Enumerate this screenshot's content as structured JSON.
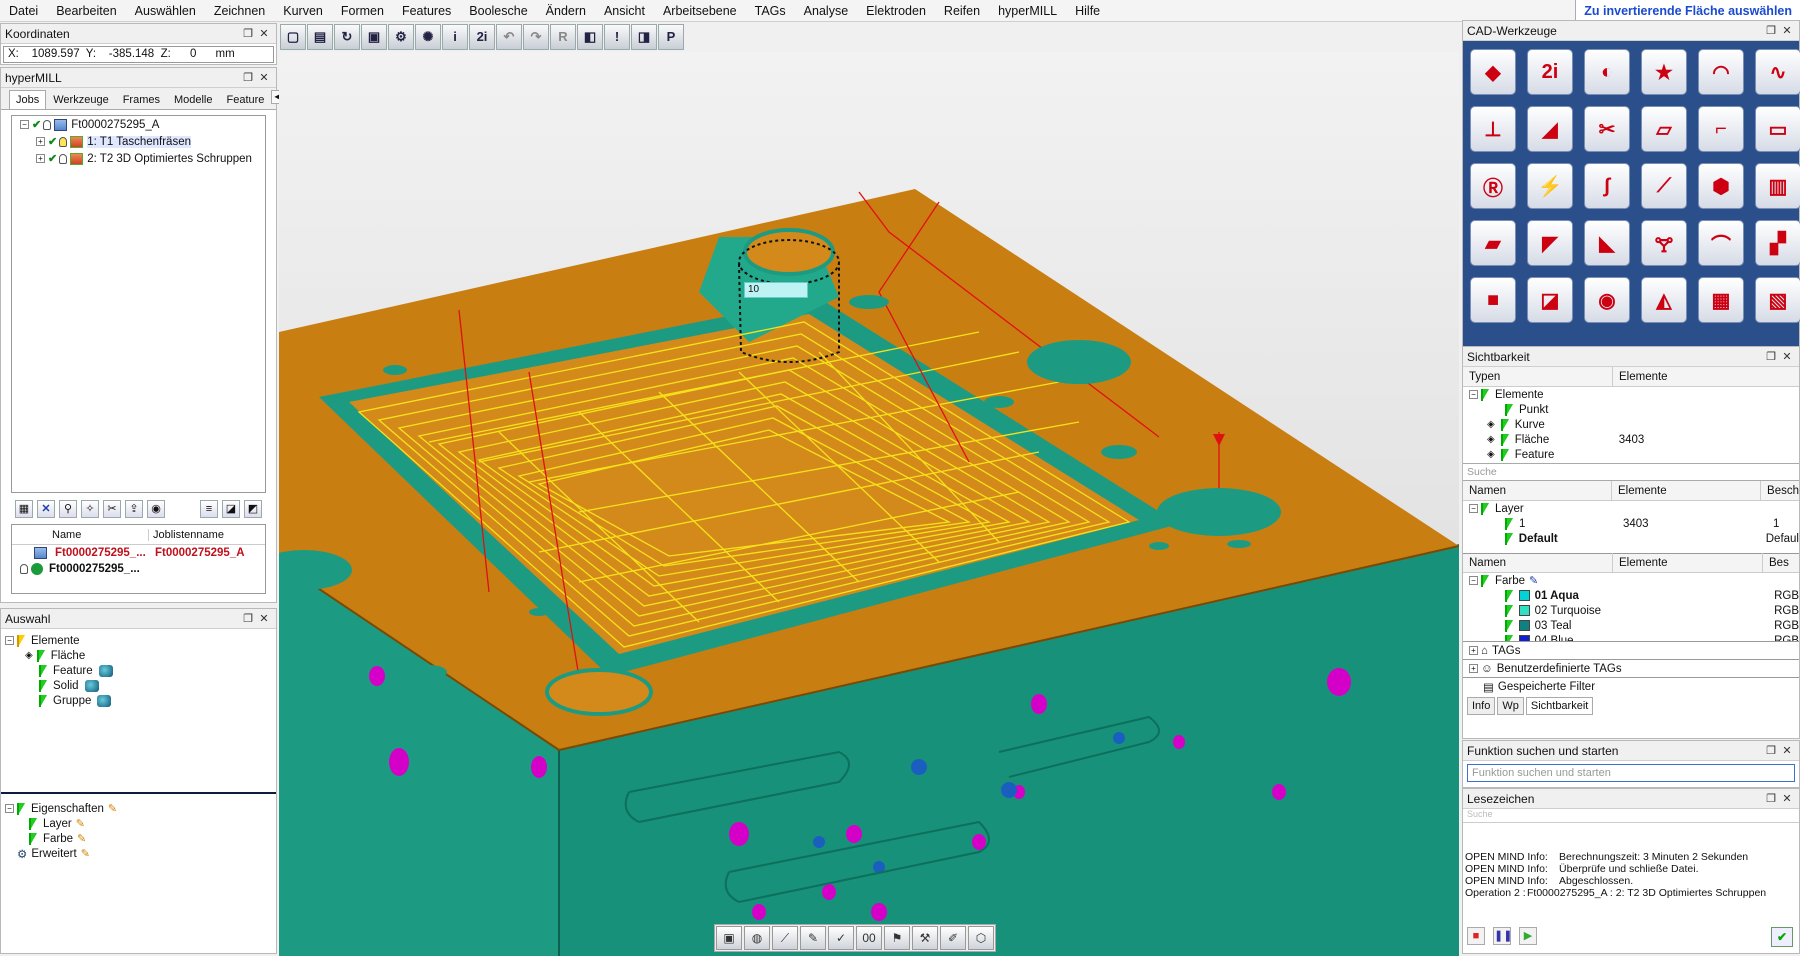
{
  "menu": [
    "Datei",
    "Bearbeiten",
    "Auswählen",
    "Zeichnen",
    "Kurven",
    "Formen",
    "Features",
    "Boolesche",
    "Ändern",
    "Ansicht",
    "Arbeitsebene",
    "TAGs",
    "Analyse",
    "Elektroden",
    "Reifen",
    "hyperMILL",
    "Hilfe"
  ],
  "status_hint": "Zu invertierende Fläche auswählen",
  "koordinaten": {
    "title": "Koordinaten",
    "readout": "X:    1089.597  Y:    -385.148  Z:      0      mm"
  },
  "hypermill": {
    "title": "hyperMILL",
    "tabs": [
      "Jobs",
      "Werkzeuge",
      "Frames",
      "Modelle",
      "Feature"
    ],
    "root": "Ft0000275295_A",
    "jobs": [
      "1: T1 Taschenfräsen",
      "2: T2 3D Optimiertes Schruppen"
    ],
    "joblist_header": {
      "name": "Name",
      "joblistname": "Joblistenname"
    },
    "joblist_rows": [
      {
        "name": "Ft0000275295_...",
        "joblistname": "Ft0000275295_A"
      },
      {
        "name": "Ft0000275295_...",
        "joblistname": ""
      }
    ]
  },
  "auswahl": {
    "title": "Auswahl",
    "items": [
      "Elemente",
      "Fläche",
      "Feature",
      "Solid",
      "Gruppe"
    ],
    "props": [
      "Eigenschaften",
      "Layer",
      "Farbe",
      "Erweitert"
    ]
  },
  "viewport": {
    "dim_value": "10",
    "colors": {
      "plate": "#c97e12",
      "walls": "#1d9b82",
      "toolpath": "#f6e21a",
      "holes": "#d400c8"
    }
  },
  "cad": {
    "title": "CAD-Werkzeuge",
    "icons": [
      "solid-icon",
      "text-2i-icon",
      "glasses-icon",
      "star-i-icon",
      "arc-icon",
      "curve-icon",
      "dimension-icon",
      "surface-icon",
      "stamp-icon",
      "folder-icon",
      "corner-icon",
      "frame-icon",
      "circle-r-icon",
      "zigzag-icon",
      "spline-icon",
      "knife-icon",
      "mesh-icon",
      "ribs-icon",
      "plane-icon",
      "sheet-icon",
      "fold-icon",
      "chalice-icon",
      "horn-icon",
      "extrude-icon",
      "box-icon",
      "step-icon",
      "cylinder-icon",
      "fan-icon",
      "pocket-icon",
      "cube-icon"
    ]
  },
  "sichtbarkeit": {
    "title": "Sichtbarkeit",
    "head1": [
      "Typen",
      "Elemente"
    ],
    "types": [
      {
        "label": "Elemente",
        "count": ""
      },
      {
        "label": "Punkt",
        "count": ""
      },
      {
        "label": "Kurve",
        "count": ""
      },
      {
        "label": "Fläche",
        "count": "3403"
      },
      {
        "label": "Feature",
        "count": ""
      }
    ],
    "search": "Suche",
    "head2": [
      "Namen",
      "Elemente",
      "Besch"
    ],
    "layers": [
      {
        "label": "Layer",
        "count": "",
        "extra": ""
      },
      {
        "label": "1",
        "count": "3403",
        "extra": "1"
      },
      {
        "label": "Default",
        "count": "",
        "extra": "Defaul"
      }
    ],
    "head3": [
      "Namen",
      "Elemente",
      "Bes"
    ],
    "colors_title": "Farbe",
    "colors": [
      {
        "label": "01 Aqua",
        "hex": "#00d4d4",
        "rgb": "RGB"
      },
      {
        "label": "02 Turquoise",
        "hex": "#30e0c0",
        "rgb": "RGB"
      },
      {
        "label": "03 Teal",
        "hex": "#108080",
        "rgb": "RGB"
      },
      {
        "label": "04 Blue",
        "hex": "#1020d0",
        "rgb": "RGB"
      }
    ],
    "sections": [
      "TAGs",
      "Benutzerdefinierte TAGs",
      "Gespeicherte Filter"
    ],
    "bottom_tabs": [
      "Info",
      "Wp",
      "Sichtbarkeit"
    ]
  },
  "funktion": {
    "title": "Funktion suchen und starten",
    "placeholder": "Funktion suchen und starten"
  },
  "lesezeichen": {
    "title": "Lesezeichen",
    "search": "Suche",
    "log": [
      {
        "k": "OPEN MIND Info:",
        "v": "Berechnungszeit: 3 Minuten 2 Sekunden"
      },
      {
        "k": "OPEN MIND Info:",
        "v": "Überprüfe und schließe Datei."
      },
      {
        "k": "OPEN MIND Info:",
        "v": "Abgeschlossen."
      },
      {
        "k": "Operation 2 :",
        "v": "Ft0000275295_A : 2: T2 3D Optimiertes Schruppen"
      }
    ]
  }
}
